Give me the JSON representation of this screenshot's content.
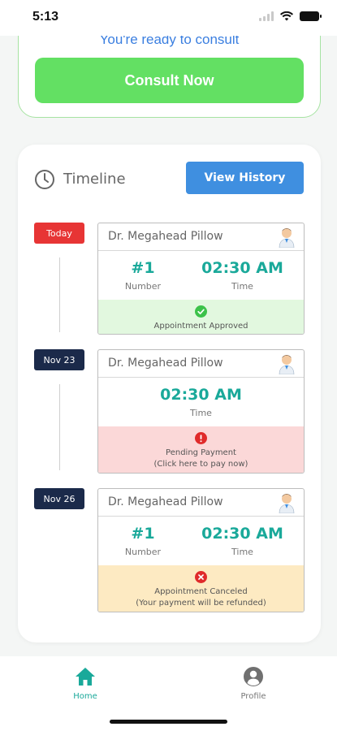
{
  "status_bar": {
    "time": "5:13"
  },
  "consult": {
    "ready_text": "You're ready to consult",
    "button_label": "Consult Now"
  },
  "timeline": {
    "title": "Timeline",
    "history_button": "View History",
    "appointments": [
      {
        "date": "Today",
        "doctor": "Dr. Megahead Pillow",
        "number": "#1",
        "number_label": "Number",
        "time": "02:30 AM",
        "time_label": "Time",
        "status_line1": "Appointment Approved",
        "status_line2": ""
      },
      {
        "date": "Nov 23",
        "doctor": "Dr. Megahead Pillow",
        "time": "02:30 AM",
        "time_label": "Time",
        "status_line1": "Pending Payment",
        "status_line2": "(Click here to pay now)"
      },
      {
        "date": "Nov 26",
        "doctor": "Dr. Megahead Pillow",
        "number": "#1",
        "number_label": "Number",
        "time": "02:30 AM",
        "time_label": "Time",
        "status_line1": "Appointment Canceled",
        "status_line2": "(Your payment will be refunded)"
      }
    ]
  },
  "nav": {
    "home": "Home",
    "profile": "Profile"
  },
  "colors": {
    "accent_green": "#63e063",
    "teal": "#1aa99a",
    "blue": "#3f8fe0",
    "today_red": "#e73535",
    "dark_badge": "#1b2a4a"
  }
}
